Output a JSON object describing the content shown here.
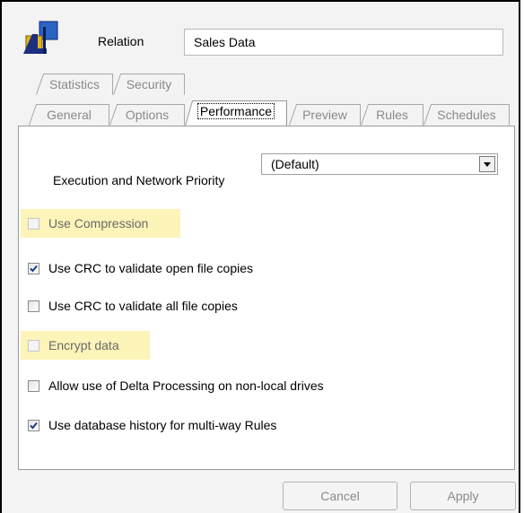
{
  "relation": {
    "label": "Relation",
    "value": "Sales Data"
  },
  "tabs_back": [
    {
      "label": "Statistics"
    },
    {
      "label": "Security"
    }
  ],
  "tabs_front": [
    {
      "label": "General"
    },
    {
      "label": "Options"
    },
    {
      "label": "Performance",
      "active": true
    },
    {
      "label": "Preview"
    },
    {
      "label": "Rules"
    },
    {
      "label": "Schedules"
    }
  ],
  "performance": {
    "priority_label": "Execution and Network Priority",
    "priority_value": "(Default)",
    "options": [
      {
        "label": "Use Compression",
        "checked": false,
        "enabled": false,
        "highlighted": true
      },
      {
        "label": "Use CRC to validate open file copies",
        "checked": true,
        "enabled": true,
        "highlighted": false
      },
      {
        "label": "Use CRC to validate all file copies",
        "checked": false,
        "enabled": true,
        "highlighted": false
      },
      {
        "label": "Encrypt data",
        "checked": false,
        "enabled": false,
        "highlighted": true
      },
      {
        "label": "Allow use of Delta Processing on non-local drives",
        "checked": false,
        "enabled": true,
        "highlighted": false
      },
      {
        "label": "Use database history for multi-way Rules",
        "checked": true,
        "enabled": true,
        "highlighted": false
      }
    ]
  },
  "buttons": {
    "cancel": "Cancel",
    "apply": "Apply"
  },
  "colors": {
    "highlight": "#fcf4b8",
    "disabled_text": "#8a8a8a",
    "check": "#1a3c8c"
  }
}
